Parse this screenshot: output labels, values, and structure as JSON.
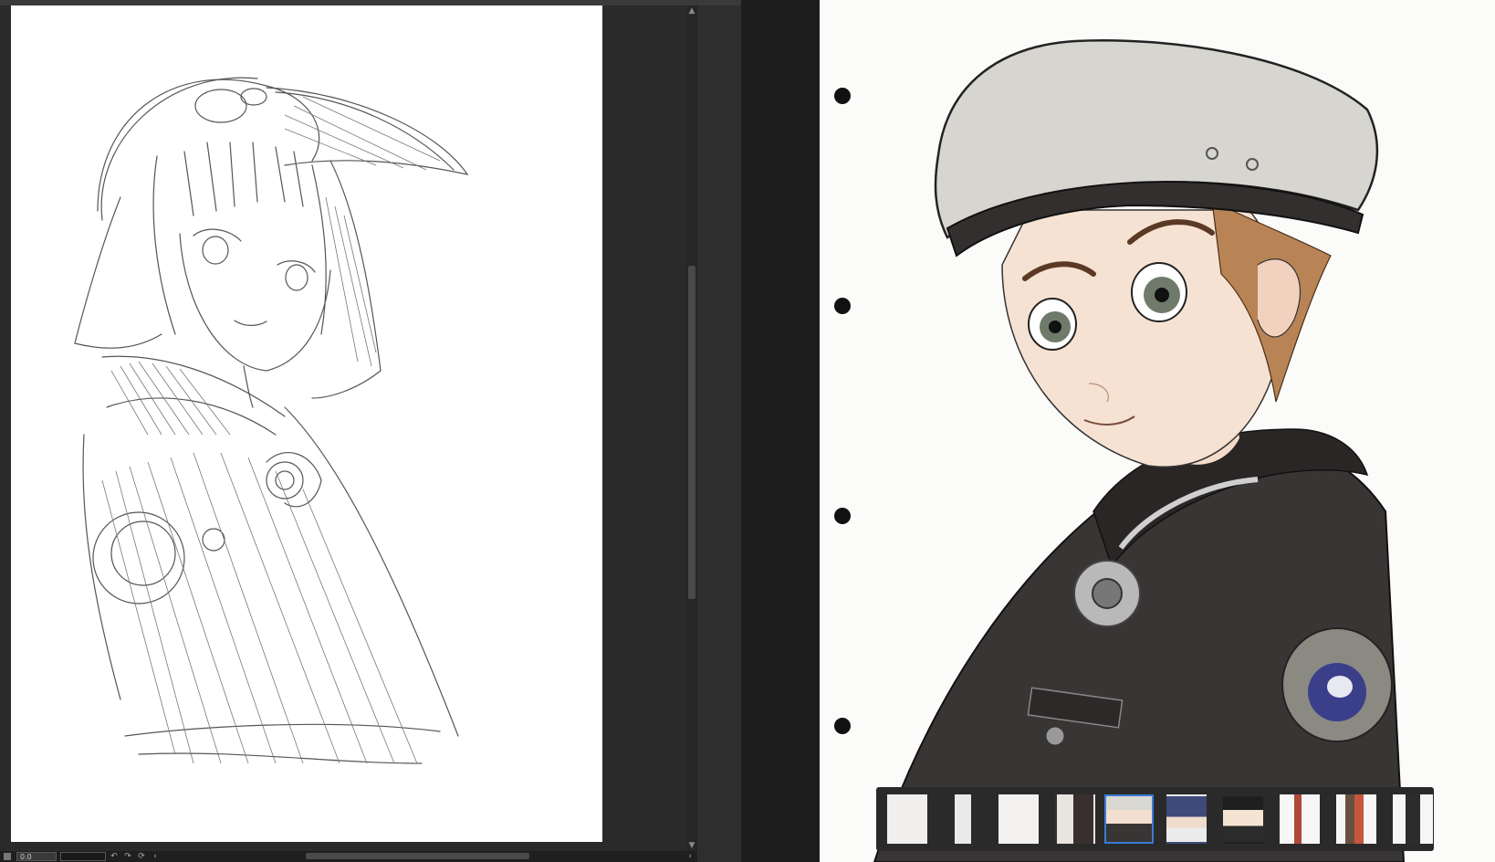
{
  "status_bar": {
    "zoom_value": "0.0"
  },
  "icons": {
    "undo": "↶",
    "redo": "↷",
    "rotate": "⟳",
    "scroll_left": "‹",
    "scroll_right": "›",
    "scroll_up": "▲",
    "scroll_down": "▼"
  },
  "filmstrip": {
    "selected_index": 4,
    "thumbnails": [
      "sketch-face",
      "sketch-partial",
      "sketch-portrait",
      "glasses-duo",
      "beret-cadet",
      "blue-hair-girl",
      "bunny-ears-girl",
      "standing-girl",
      "pair-figures",
      "cropped-figure"
    ]
  },
  "colors": {
    "accent_selection": "#3a7bd5",
    "app_bg": "#2c2c2c",
    "paper": "#ffffff"
  }
}
